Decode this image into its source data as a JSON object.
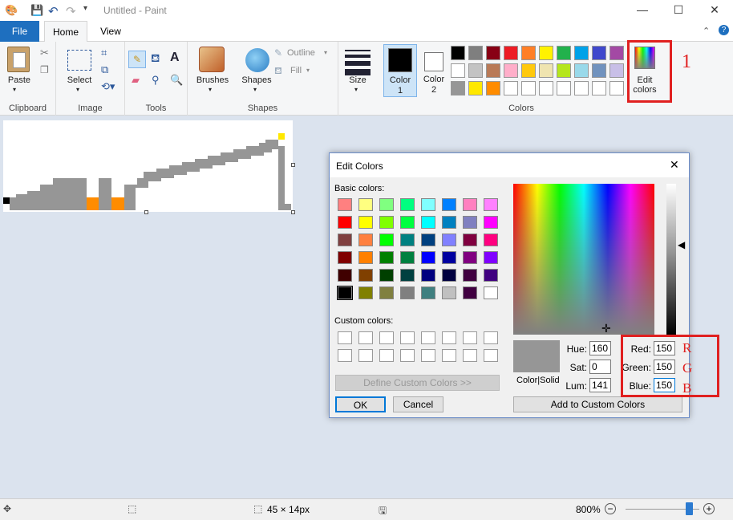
{
  "window": {
    "title": "Untitled - Paint"
  },
  "tabs": {
    "file": "File",
    "home": "Home",
    "view": "View"
  },
  "ribbon": {
    "paste": "Paste",
    "clipboard": "Clipboard",
    "select": "Select",
    "image": "Image",
    "tools": "Tools",
    "brushes": "Brushes",
    "shapes_btn": "Shapes",
    "outline": "Outline",
    "fill": "Fill",
    "shapes": "Shapes",
    "size": "Size",
    "color1_a": "Color",
    "color1_b": "1",
    "color2_a": "Color",
    "color2_b": "2",
    "colors": "Colors",
    "edit_colors_a": "Edit",
    "edit_colors_b": "colors",
    "palette_row1": [
      "#000000",
      "#7f7f7f",
      "#880015",
      "#ed1c24",
      "#ff7f27",
      "#fff200",
      "#22b14c",
      "#00a2e8",
      "#3f48cc",
      "#a349a4"
    ],
    "palette_row2": [
      "#ffffff",
      "#c3c3c3",
      "#b97a57",
      "#ffaec9",
      "#ffc90e",
      "#efe4b0",
      "#b5e61d",
      "#99d9ea",
      "#7092be",
      "#c8bfe7"
    ],
    "palette_row3": [
      "#969696",
      "#ffe800",
      "#ff8c00",
      "#ffffff",
      "#ffffff",
      "#ffffff",
      "#ffffff",
      "#ffffff",
      "#ffffff",
      "#ffffff"
    ]
  },
  "dialog": {
    "title": "Edit Colors",
    "basic_label": "Basic colors:",
    "custom_label": "Custom colors:",
    "define_custom": "Define Custom Colors >>",
    "ok": "OK",
    "cancel": "Cancel",
    "color_solid": "Color|Solid",
    "hue_label": "Hue:",
    "hue": "160",
    "sat_label": "Sat:",
    "sat": "0",
    "lum_label": "Lum:",
    "lum": "141",
    "red_label": "Red:",
    "red": "150",
    "green_label": "Green:",
    "green": "150",
    "blue_label": "Blue:",
    "blue": "150",
    "add_custom": "Add to Custom Colors",
    "basic_colors": [
      "#ff8080",
      "#ffff80",
      "#80ff80",
      "#00ff80",
      "#80ffff",
      "#0080ff",
      "#ff80c0",
      "#ff80ff",
      "#ff0000",
      "#ffff00",
      "#80ff00",
      "#00ff40",
      "#00ffff",
      "#0080c0",
      "#8080c0",
      "#ff00ff",
      "#804040",
      "#ff8040",
      "#00ff00",
      "#008080",
      "#004080",
      "#8080ff",
      "#800040",
      "#ff0080",
      "#800000",
      "#ff8000",
      "#008000",
      "#008040",
      "#0000ff",
      "#0000a0",
      "#800080",
      "#8000ff",
      "#400000",
      "#804000",
      "#004000",
      "#004040",
      "#000080",
      "#000040",
      "#400040",
      "#400080",
      "#000000",
      "#808000",
      "#808040",
      "#808080",
      "#408080",
      "#c0c0c0",
      "#400040",
      "#ffffff"
    ]
  },
  "annotations": {
    "step": "1",
    "r": "R",
    "g": "G",
    "b": "B"
  },
  "status": {
    "size": "45 × 14px",
    "zoom": "800%"
  }
}
